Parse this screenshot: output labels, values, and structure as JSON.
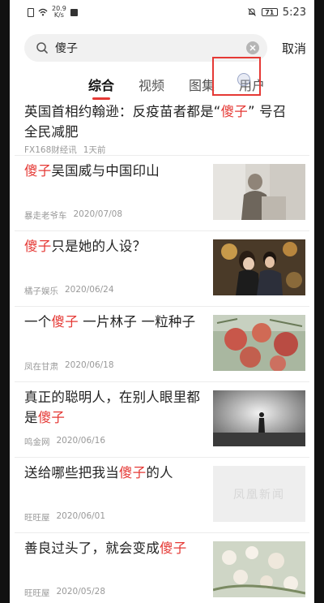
{
  "status_bar": {
    "speed_value": "20.9",
    "speed_unit": "K/s",
    "battery": "71",
    "time": "5:23"
  },
  "search": {
    "value": "傻子",
    "cancel_label": "取消"
  },
  "tabs": [
    {
      "label": "综合",
      "active": true
    },
    {
      "label": "视频",
      "active": false
    },
    {
      "label": "图集",
      "active": false
    },
    {
      "label": "用户",
      "active": false
    }
  ],
  "colors": {
    "keyword": "#e53935",
    "highlight_box": "#e53935"
  },
  "results": [
    {
      "title_parts": [
        "英国首相约翰逊：反疫苗者都是“",
        "傻子",
        "” 号召全民减肥"
      ],
      "source": "FX168财经讯",
      "time": "1天前",
      "image": null
    },
    {
      "title_parts": [
        "",
        "傻子",
        "吴国威与中国印山"
      ],
      "source": "暴走老爷车",
      "time": "2020/07/08",
      "image": "old-man-photo"
    },
    {
      "title_parts": [
        "",
        "傻子",
        "只是她的人设？"
      ],
      "source": "橘子娱乐",
      "time": "2020/06/24",
      "image": "couple-photo"
    },
    {
      "title_parts": [
        "一个",
        "傻子",
        " 一片林子 一粒种子"
      ],
      "source": "凤在甘肃",
      "time": "2020/06/18",
      "image": "fruit-photo"
    },
    {
      "title_parts": [
        "真正的聪明人，在别人眼里都是",
        "傻子",
        ""
      ],
      "source": "鸣金网",
      "time": "2020/06/16",
      "image": "silhouette-photo"
    },
    {
      "title_parts": [
        "送给哪些把我当",
        "傻子",
        "的人"
      ],
      "source": "旺旺屋",
      "time": "2020/06/01",
      "image": "placeholder",
      "image_text": "凤凰新闻"
    },
    {
      "title_parts": [
        "善良过头了，就会变成",
        "傻子",
        ""
      ],
      "source": "旺旺屋",
      "time": "2020/05/28",
      "image": "flowers-photo"
    }
  ]
}
